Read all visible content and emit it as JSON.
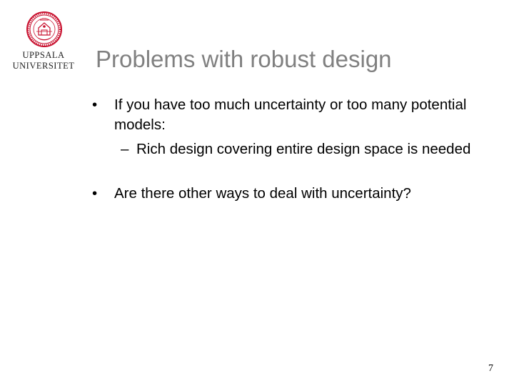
{
  "logo": {
    "line1": "UPPSALA",
    "line2": "UNIVERSITET",
    "seal_icon": "university-seal-icon",
    "seal_color": "#c8102e"
  },
  "slide": {
    "title": "Problems with robust design",
    "bullets": [
      {
        "marker": "•",
        "text": "If you have too much uncertainty or too many potential models:",
        "sub": [
          {
            "marker": "–",
            "text": "Rich design covering entire design space is needed"
          }
        ]
      },
      {
        "marker": "•",
        "text": "Are there other ways to deal with uncertainty?"
      }
    ],
    "page_number": "7"
  },
  "colors": {
    "title": "#808080",
    "body": "#000000",
    "background": "#ffffff"
  }
}
